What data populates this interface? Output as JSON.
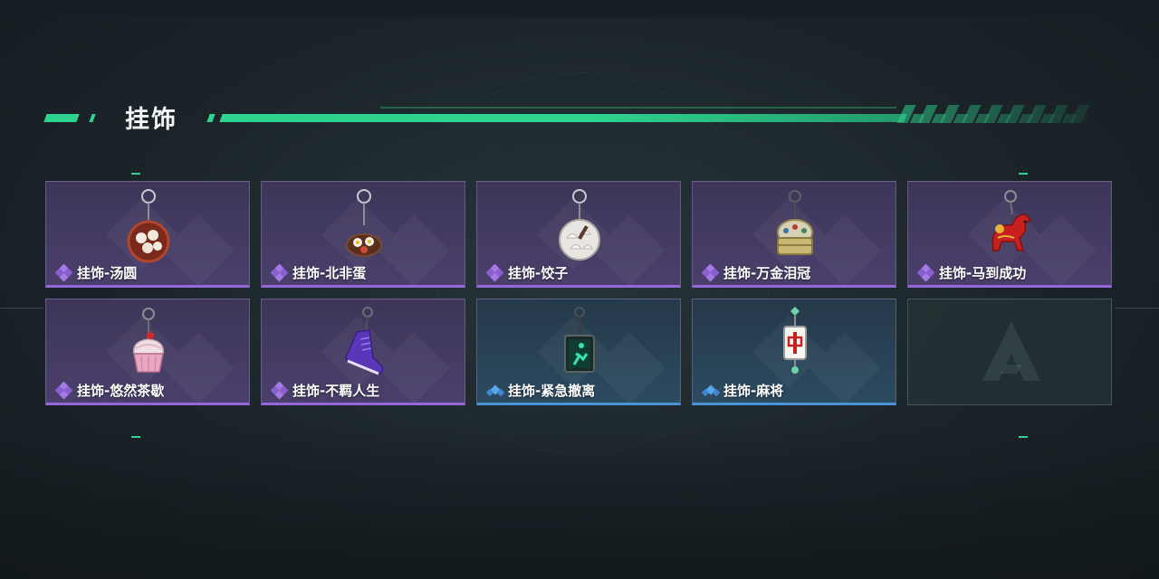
{
  "section": {
    "title": "挂饰"
  },
  "colors": {
    "accent": "#2ed38f",
    "rarity_purple": "#9667d8",
    "rarity_blue": "#4a93d8"
  },
  "items": [
    {
      "label": "挂饰-汤圆",
      "rarity": "purple",
      "icon": "tangyuan-charm-icon"
    },
    {
      "label": "挂饰-北非蛋",
      "rarity": "purple",
      "icon": "shakshuka-charm-icon"
    },
    {
      "label": "挂饰-饺子",
      "rarity": "purple",
      "icon": "dumpling-charm-icon"
    },
    {
      "label": "挂饰-万金泪冠",
      "rarity": "purple",
      "icon": "crown-charm-icon"
    },
    {
      "label": "挂饰-马到成功",
      "rarity": "purple",
      "icon": "horse-charm-icon"
    },
    {
      "label": "挂饰-悠然茶歇",
      "rarity": "purple",
      "icon": "cupcake-charm-icon"
    },
    {
      "label": "挂饰-不羁人生",
      "rarity": "purple",
      "icon": "sneaker-charm-icon"
    },
    {
      "label": "挂饰-紧急撤离",
      "rarity": "blue",
      "icon": "exit-sign-charm-icon"
    },
    {
      "label": "挂饰-麻将",
      "rarity": "blue",
      "icon": "mahjong-charm-icon"
    }
  ]
}
